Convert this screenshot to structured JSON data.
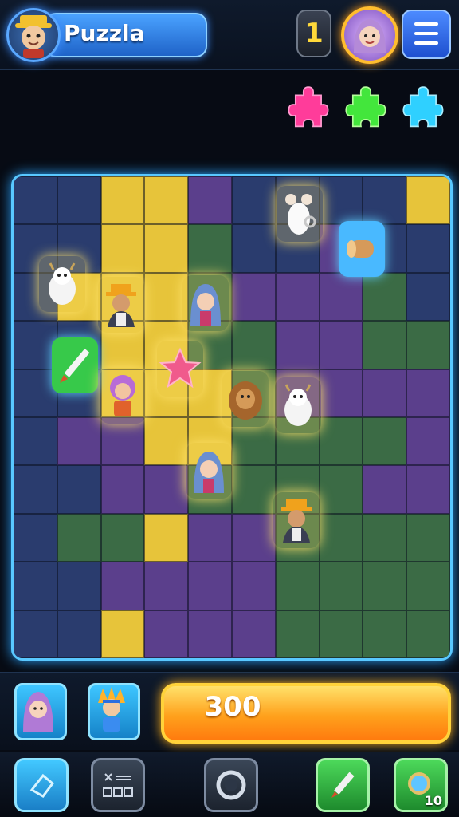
{
  "header": {
    "player_name": "Puzzla",
    "counter_value": "1"
  },
  "toolbar": {
    "hint_count": "10"
  },
  "score": {
    "value": "300"
  },
  "colors": {
    "yellow": "#e7c43a",
    "purple": "#5b3f8c",
    "green": "#3b6b45",
    "blue": "#2a3c6e",
    "accent_blue": "#3fb8ff",
    "score_orange": "#ff9a1a"
  },
  "icons": {
    "collected": [
      "pink-puzzle-piece-icon",
      "green-puzzle-piece-icon",
      "cyan-puzzle-piece-icon"
    ],
    "board_tokens": [
      "white-goat",
      "villager-orange-hat",
      "hooded-girl",
      "pencil",
      "pink-star",
      "pink-haired-child",
      "brown-lion",
      "white-goat",
      "hooded-girl",
      "villager-orange-hat",
      "mouse-with-ring",
      "wooden-log"
    ],
    "bottom_tools": [
      "eraser-icon",
      "calculator-icon",
      "camera-icon",
      "pencil-icon",
      "magnifier-icon"
    ]
  }
}
